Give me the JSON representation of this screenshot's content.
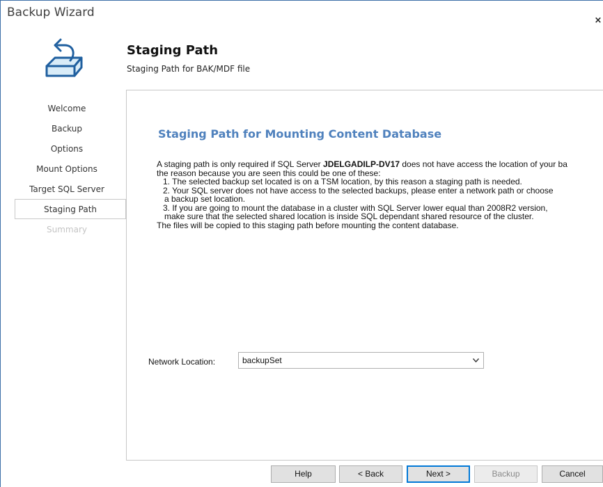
{
  "window": {
    "title": "Backup Wizard",
    "close_glyph": "×"
  },
  "header": {
    "logo_icon": "backup-disk-arrow-icon",
    "title": "Staging Path",
    "subtitle": "Staging Path for BAK/MDF file"
  },
  "steps": [
    {
      "label": "Welcome",
      "state": "normal"
    },
    {
      "label": "Backup",
      "state": "normal"
    },
    {
      "label": "Options",
      "state": "normal"
    },
    {
      "label": "Mount Options",
      "state": "normal"
    },
    {
      "label": "Target SQL Server",
      "state": "normal"
    },
    {
      "label": "Staging Path",
      "state": "active"
    },
    {
      "label": "Summary",
      "state": "disabled"
    }
  ],
  "content": {
    "section_title": "Staging Path for Mounting Content Database",
    "intro_before": "A staging path is only required if SQL Server ",
    "server_name": "JDELGADILP-DV17",
    "intro_after": " does not have access the location of your ba",
    "line2": "the reason because you are seen this could be one of these:",
    "item1": "1. The selected backup set located is on a TSM location, by this reason a staging path is needed.",
    "item2a": "2. Your SQL server does not have access to the selected backups, please enter a network path or choose",
    "item2b": "a backup set location.",
    "item3a": "3. If you are going to mount the database in a cluster with SQL Server lower equal than 2008R2 version,",
    "item3b": "make sure that the selected shared location is inside SQL dependant shared resource of the cluster.",
    "footer_line": "The files will be copied to this staging path before mounting the content database.",
    "network_label": "Network Location:",
    "network_value": "backupSet"
  },
  "buttons": {
    "help": "Help",
    "back": "< Back",
    "next": "Next >",
    "backup": "Backup",
    "cancel": "Cancel"
  },
  "colors": {
    "accent": "#4f81bd",
    "window_border": "#3c6fa8",
    "logo_stroke": "#1f5f9f",
    "logo_fill": "#d9ecf8"
  }
}
